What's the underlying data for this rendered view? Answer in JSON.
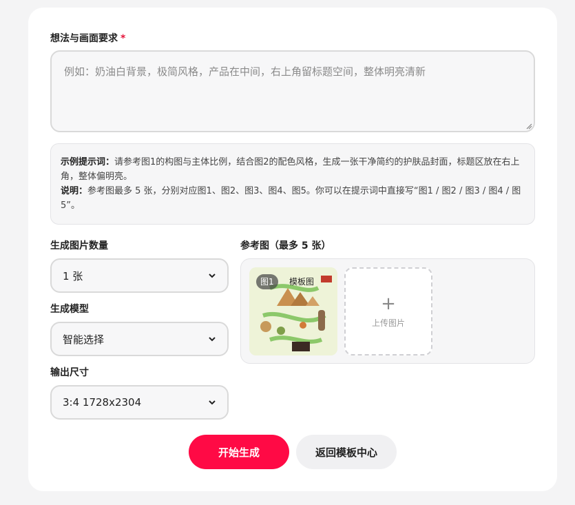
{
  "idea": {
    "label": "想法与画面要求",
    "required_mark": "*",
    "placeholder": "例如：奶油白背景，极简风格，产品在中间，右上角留标题空间，整体明亮清新"
  },
  "hint": {
    "example_title": "示例提示词：",
    "example_text": "请参考图1的构图与主体比例，结合图2的配色风格，生成一张干净简约的护肤品封面，标题区放在右上角，整体偏明亮。",
    "note_title": "说明：",
    "note_text": "参考图最多 5 张，分别对应图1、图2、图3、图4、图5。你可以在提示词中直接写“图1 / 图2 / 图3 / 图4 / 图5”。"
  },
  "count": {
    "label": "生成图片数量",
    "value": "1 张"
  },
  "model": {
    "label": "生成模型",
    "value": "智能选择"
  },
  "size": {
    "label": "输出尺寸",
    "value": "3:4 1728x2304"
  },
  "reference": {
    "label": "参考图（最多 5 张）",
    "thumb_badge": "图1",
    "thumb_tag": "模板图",
    "upload_label": "上传图片"
  },
  "actions": {
    "start": "开始生成",
    "back": "返回模板中心"
  },
  "colors": {
    "accent": "#ff0a45",
    "required": "#e5153b"
  }
}
